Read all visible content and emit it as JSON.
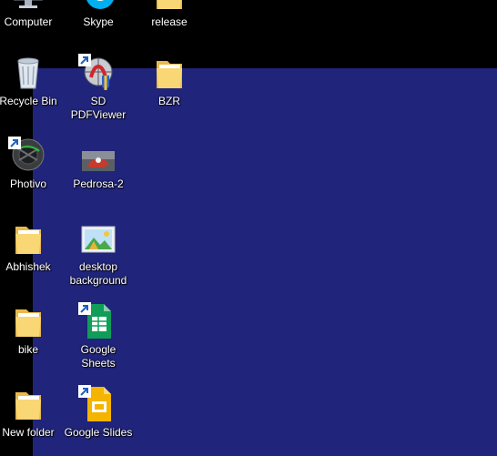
{
  "colors": {
    "wallpaper": "#20247a",
    "background": "#000000",
    "label": "#ffffff"
  },
  "desktop": {
    "icons": [
      {
        "label": "Computer",
        "icon": "computer-icon",
        "shortcut": false
      },
      {
        "label": "Skype",
        "icon": "skype-icon",
        "shortcut": true
      },
      {
        "label": "release",
        "icon": "folder-icon",
        "shortcut": false
      },
      {
        "label": "Recycle Bin",
        "icon": "recycle-bin-icon",
        "shortcut": false
      },
      {
        "label": "SD PDFViewer",
        "icon": "pdf-viewer-icon",
        "shortcut": true
      },
      {
        "label": "BZR",
        "icon": "folder-icon",
        "shortcut": false
      },
      {
        "label": "Photivo",
        "icon": "photivo-icon",
        "shortcut": true
      },
      {
        "label": "Pedrosa-2",
        "icon": "image-thumbnail-icon",
        "shortcut": false
      },
      {
        "label": "Abhishek",
        "icon": "folder-icon",
        "shortcut": false
      },
      {
        "label": "desktop background",
        "icon": "image-file-icon",
        "shortcut": false
      },
      {
        "label": "bike",
        "icon": "folder-icon",
        "shortcut": false
      },
      {
        "label": "Google Sheets",
        "icon": "google-sheets-icon",
        "shortcut": true
      },
      {
        "label": "New folder",
        "icon": "folder-icon",
        "shortcut": false
      },
      {
        "label": "Google Slides",
        "icon": "google-slides-icon",
        "shortcut": true
      }
    ]
  }
}
